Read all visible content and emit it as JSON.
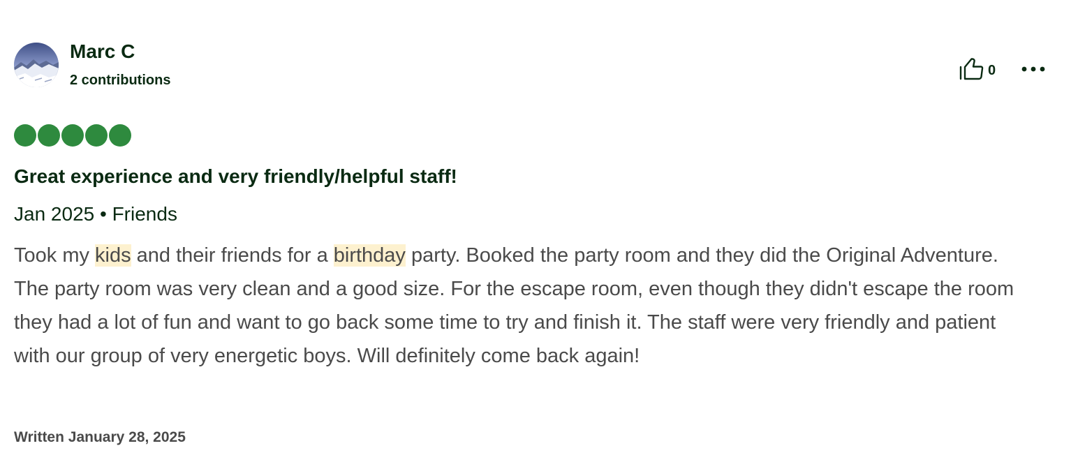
{
  "reviewer": {
    "name": "Marc C",
    "contributions": "2 contributions"
  },
  "actions": {
    "helpful_count": "0",
    "helpful_icon": "thumbs-up-icon",
    "more_icon": "more-options-icon"
  },
  "rating": {
    "value": 5,
    "max": 5,
    "color": "#2e8a3e"
  },
  "review": {
    "title": "Great experience and very friendly/helpful staff!",
    "meta": "Jan 2025 • Friends",
    "body": {
      "part1": "Took my ",
      "hl1": "kids",
      "part2": " and their friends for a ",
      "hl2": "birthday",
      "part3": " party. Booked the party room and they did the Original Adventure. The party room was very clean and a good size. For the escape room, even though they didn't escape the room they had a lot of fun and want to go back some time to try and finish it. The staff were very friendly and patient with our group of very energetic boys. Will definitely come back again!"
    },
    "written": "Written January 28, 2025"
  },
  "colors": {
    "heading": "#0a2a12",
    "body": "#4a4a4a",
    "highlight": "#fdf1cf"
  }
}
